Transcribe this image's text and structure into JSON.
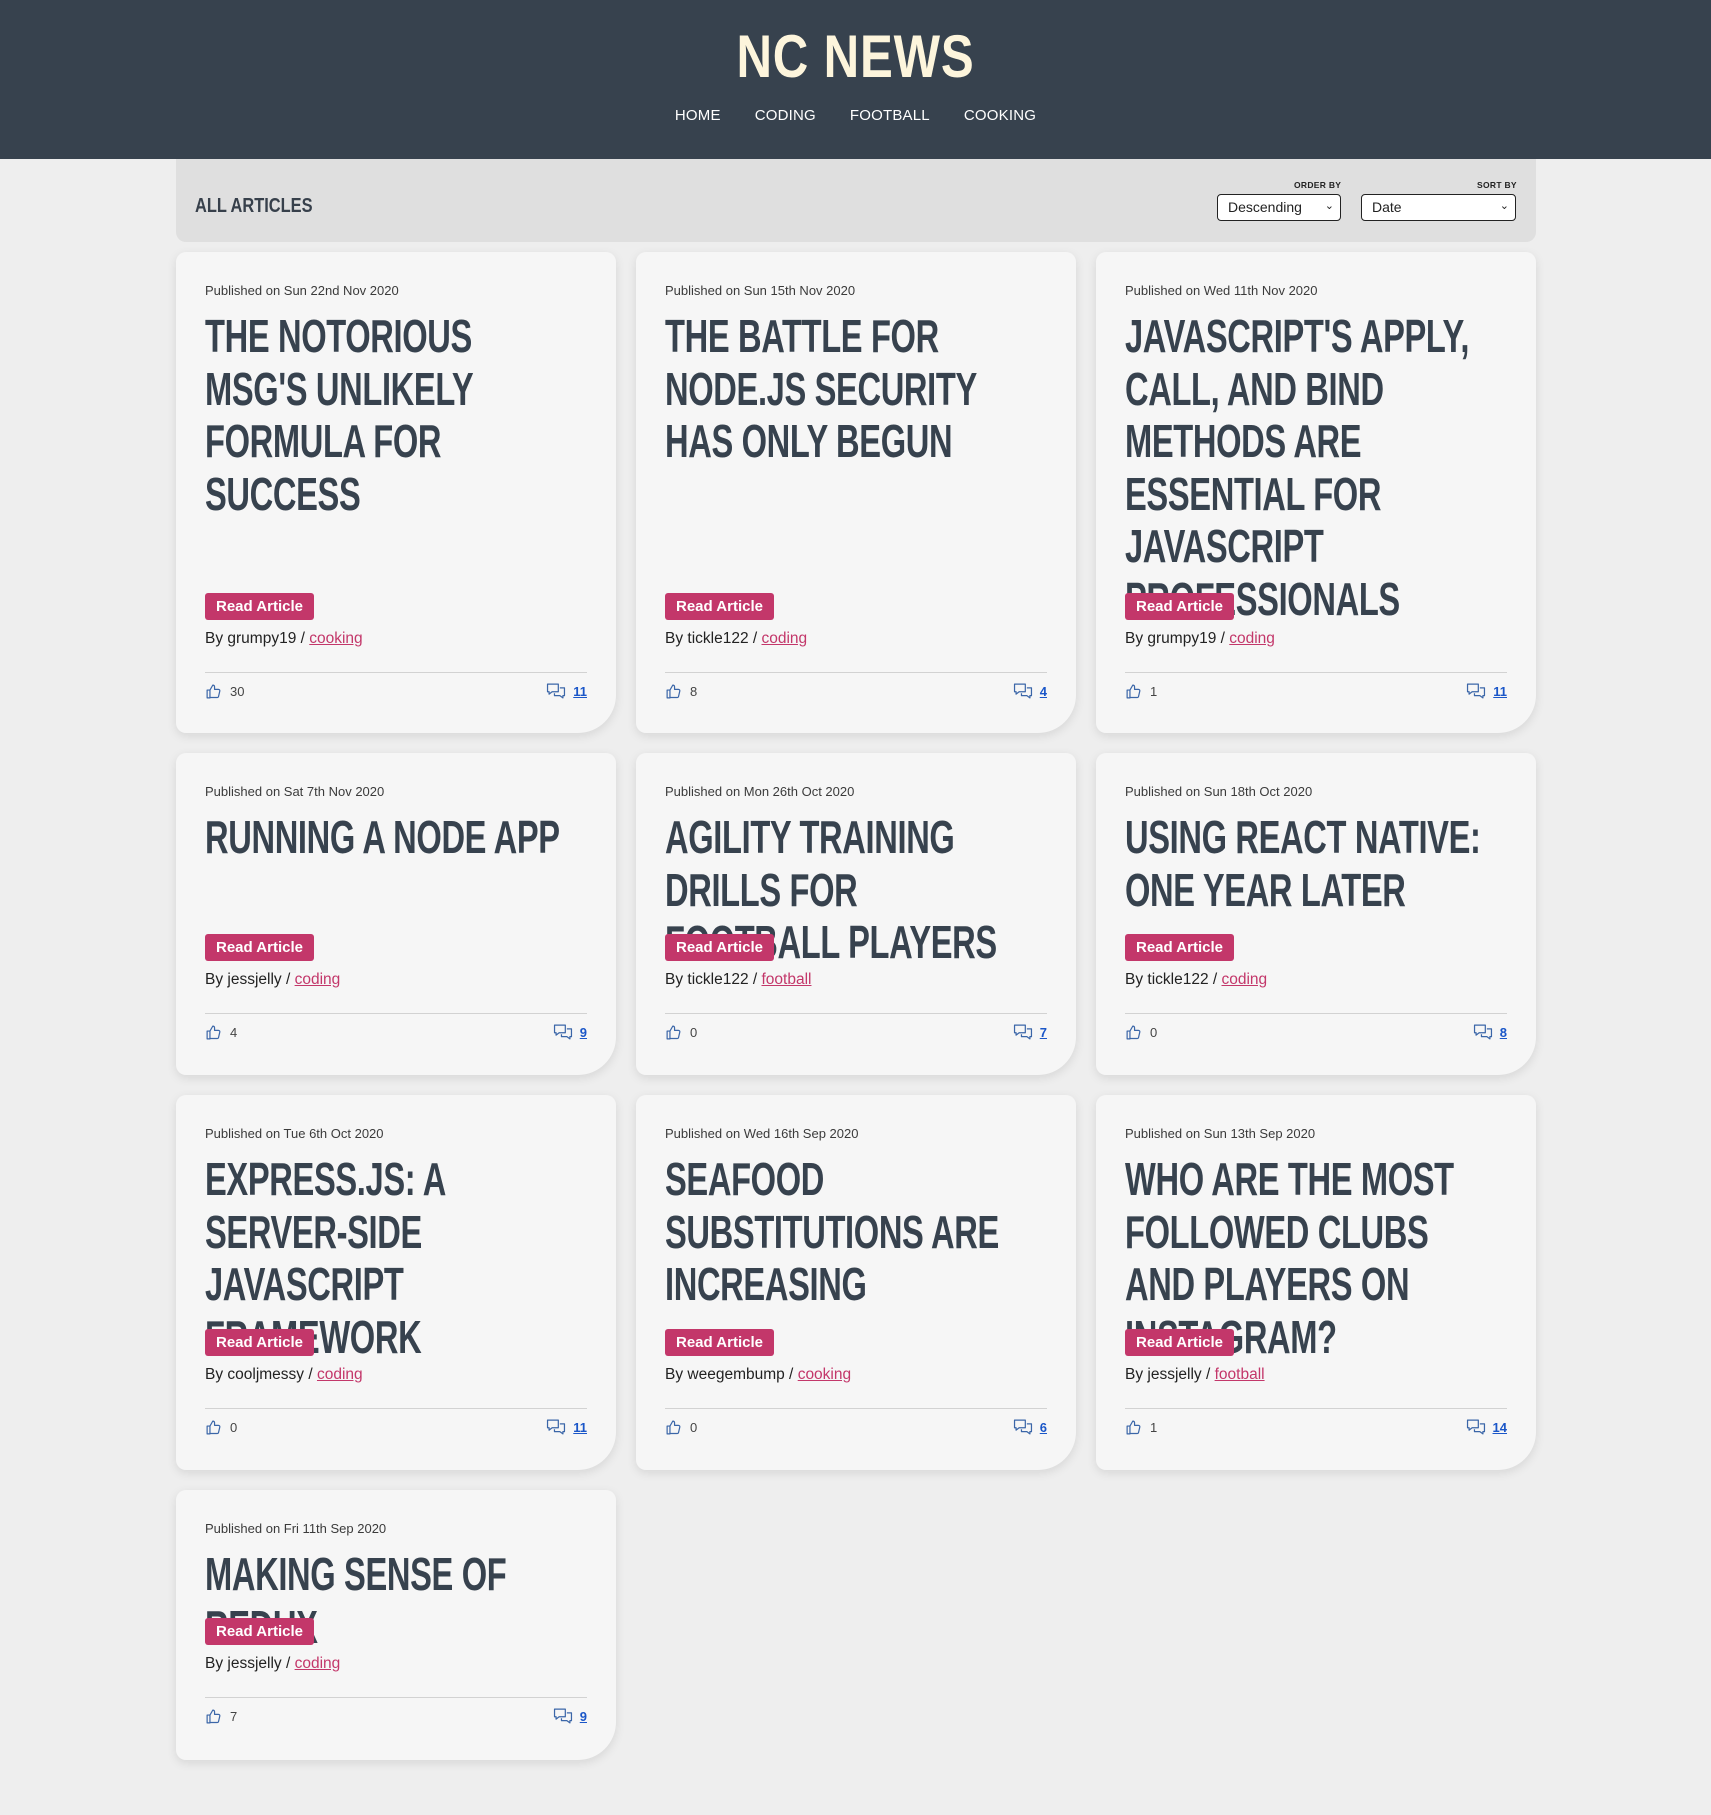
{
  "site": {
    "logo": "NC NEWS",
    "nav": [
      "HOME",
      "CODING",
      "FOOTBALL",
      "COOKING"
    ]
  },
  "toolbar": {
    "heading": "ALL ARTICLES",
    "order_by_label": "ORDER BY",
    "order_by_value": "Descending",
    "sort_by_label": "SORT BY",
    "sort_by_value": "Date"
  },
  "colors": {
    "header_bg": "#37424e",
    "logo": "#fdf5dc",
    "accent": "#c3376a",
    "link": "#1a56c8",
    "card_bg": "#f6f6f6",
    "page_bg": "#eeeeee"
  },
  "icons": {
    "vote": "thumbs-up-icon",
    "comments": "comments-icon",
    "chevron": "chevron-down-icon"
  },
  "read_label": "Read Article",
  "articles": [
    {
      "date": "Published on Sun 22nd Nov 2020",
      "title": "The Notorious MSG's Unlikely Formula For Success",
      "by": "By grumpy19 / ",
      "topic": "cooking",
      "votes": "30",
      "comments": "11"
    },
    {
      "date": "Published on Sun 15th Nov 2020",
      "title": "The battle for Node.js security has only begun",
      "by": "By tickle122 / ",
      "topic": "coding",
      "votes": "8",
      "comments": "4"
    },
    {
      "date": "Published on Wed 11th Nov 2020",
      "title": "JavaScript's Apply, Call, and Bind Methods are Essential for JavaScript Professionals",
      "by": "By grumpy19 / ",
      "topic": "coding",
      "votes": "1",
      "comments": "11"
    },
    {
      "date": "Published on Sat 7th Nov 2020",
      "title": "Running a Node App",
      "by": "By jessjelly / ",
      "topic": "coding",
      "votes": "4",
      "comments": "9"
    },
    {
      "date": "Published on Mon 26th Oct 2020",
      "title": "Agility Training Drills For Football Players",
      "by": "By tickle122 / ",
      "topic": "football",
      "votes": "0",
      "comments": "7"
    },
    {
      "date": "Published on Sun 18th Oct 2020",
      "title": "Using React Native: One Year Later",
      "by": "By tickle122 / ",
      "topic": "coding",
      "votes": "0",
      "comments": "8"
    },
    {
      "date": "Published on Tue 6th Oct 2020",
      "title": "Express.js: A Server-Side JavaScript Framework",
      "by": "By cooljmessy / ",
      "topic": "coding",
      "votes": "0",
      "comments": "11"
    },
    {
      "date": "Published on Wed 16th Sep 2020",
      "title": "Seafood substitutions are increasing",
      "by": "By weegembump / ",
      "topic": "cooking",
      "votes": "0",
      "comments": "6"
    },
    {
      "date": "Published on Sun 13th Sep 2020",
      "title": "Who are the most followed clubs and players on Instagram?",
      "by": "By jessjelly / ",
      "topic": "football",
      "votes": "1",
      "comments": "14"
    },
    {
      "date": "Published on Fri 11th Sep 2020",
      "title": "Making sense of Redux",
      "by": "By jessjelly / ",
      "topic": "coding",
      "votes": "7",
      "comments": "9"
    }
  ]
}
